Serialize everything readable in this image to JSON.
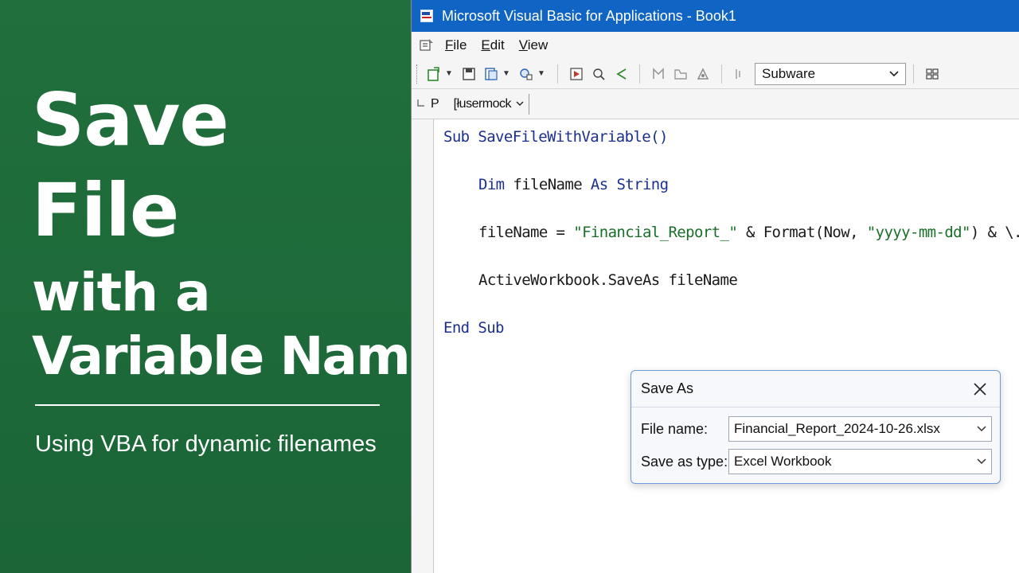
{
  "thumbnail": {
    "title_lines": [
      "Save",
      "File",
      "with a",
      "Variable Name"
    ],
    "subtitle": "Using VBA for dynamic filenames",
    "background_color": "#1d6b3a"
  },
  "window": {
    "title": "Microsoft Visual Basic for Applications - Book1",
    "titlebar_color": "#0f64c4"
  },
  "menu": {
    "items": [
      {
        "accel": "F",
        "rest": "ile"
      },
      {
        "accel": "E",
        "rest": "dit"
      },
      {
        "accel": "V",
        "rest": "iew"
      }
    ]
  },
  "toolbar": {
    "combo_value": "Subware",
    "icons": [
      "insert-module-icon",
      "save-icon",
      "paste-icon",
      "run-icon",
      "break-icon",
      "reset-icon",
      "design-mode-icon",
      "project-explorer-icon"
    ]
  },
  "procedure_bar": {
    "label": "P",
    "dropdown_value": "[łusermock"
  },
  "code": {
    "line1_kw": "Sub ",
    "line1_name": "SaveFileWithVariable()",
    "line2_kw1": "Dim ",
    "line2_var": "fileName ",
    "line2_kw2": "As String",
    "line3_a": "fileName = ",
    "line3_str1": "\"Financial_Report_\"",
    "line3_b": " & Format(Now, ",
    "line3_str2": "\"yyyy-mm-dd\"",
    "line3_c": ") & \\.xlsx\"",
    "line4": "ActiveWorkbook.SaveAs fileName",
    "line5_kw": "End Sub",
    "keyword_color": "#1c2f8c",
    "string_color": "#1a6e2a"
  },
  "save_dialog": {
    "title": "Save As",
    "filename_label": "File name:",
    "filename_value": "Financial_Report_2024-10-26.xlsx",
    "savetype_label": "Save as type:",
    "savetype_value": "Excel Workbook"
  }
}
